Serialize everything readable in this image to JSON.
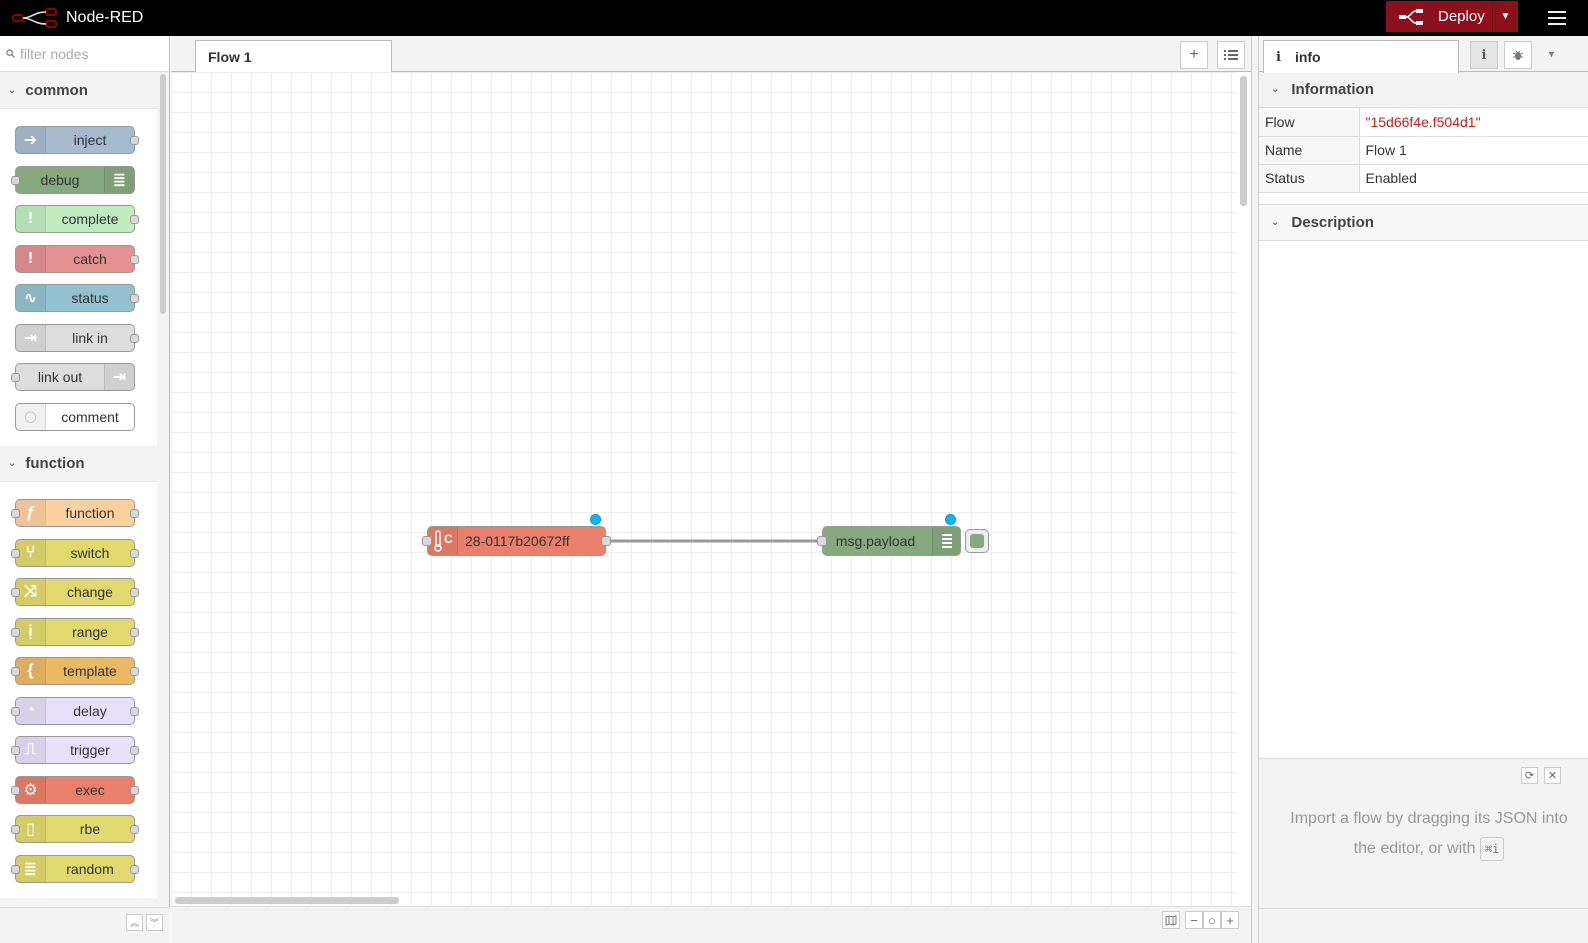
{
  "header": {
    "app_title": "Node-RED",
    "deploy_label": "Deploy"
  },
  "palette": {
    "search_placeholder": "filter nodes",
    "categories": [
      {
        "name": "common",
        "nodes": [
          {
            "label": "inject",
            "color": "#a6bbcf",
            "icon": "arrow-right-icon",
            "ports": "out"
          },
          {
            "label": "debug",
            "color": "#87a980",
            "icon": "list-icon",
            "ports": "in",
            "icon_side": "right"
          },
          {
            "label": "complete",
            "color": "#c0edc0",
            "icon": "exclamation-icon",
            "ports": "out"
          },
          {
            "label": "catch",
            "color": "#e49191",
            "icon": "exclamation-icon",
            "ports": "out"
          },
          {
            "label": "status",
            "color": "#94c1d0",
            "icon": "pulse-icon",
            "ports": "out"
          },
          {
            "label": "link in",
            "color": "#dddddd",
            "icon": "link-in-icon",
            "ports": "out"
          },
          {
            "label": "link out",
            "color": "#dddddd",
            "icon": "link-out-icon",
            "ports": "in",
            "icon_side": "right"
          },
          {
            "label": "comment",
            "color": "#ffffff",
            "icon": "comment-icon",
            "ports": "none"
          }
        ]
      },
      {
        "name": "function",
        "nodes": [
          {
            "label": "function",
            "color": "#fdd0a2",
            "icon": "function-icon",
            "ports": "both"
          },
          {
            "label": "switch",
            "color": "#e2d96e",
            "icon": "switch-icon",
            "ports": "both"
          },
          {
            "label": "change",
            "color": "#e2d96e",
            "icon": "shuffle-icon",
            "ports": "both"
          },
          {
            "label": "range",
            "color": "#e2d96e",
            "icon": "range-icon",
            "ports": "both"
          },
          {
            "label": "template",
            "color": "#ebb963",
            "icon": "brace-icon",
            "ports": "both"
          },
          {
            "label": "delay",
            "color": "#e6e0f8",
            "icon": "timer-icon",
            "ports": "both"
          },
          {
            "label": "trigger",
            "color": "#e6e0f8",
            "icon": "trigger-icon",
            "ports": "both"
          },
          {
            "label": "exec",
            "color": "#e9806b",
            "icon": "gear-icon",
            "ports": "both"
          },
          {
            "label": "rbe",
            "color": "#e2d96e",
            "icon": "rbe-icon",
            "ports": "both"
          },
          {
            "label": "random",
            "color": "#e2d96e",
            "icon": "random-icon",
            "ports": "both"
          }
        ]
      }
    ]
  },
  "workspace": {
    "tab_label": "Flow 1",
    "flow_nodes": [
      {
        "label": "28-0117b20672ff",
        "color": "#e9806b",
        "icon": "thermometer-icon",
        "glyph": "C"
      },
      {
        "label": "msg.payload",
        "color": "#87a980",
        "icon": "list-icon"
      }
    ]
  },
  "sidebar": {
    "tab_label": "info",
    "section_info": "Information",
    "section_desc": "Description",
    "rows": [
      {
        "key": "Flow",
        "value": "\"15d66f4e.f504d1\""
      },
      {
        "key": "Name",
        "value": "Flow 1"
      },
      {
        "key": "Status",
        "value": "Enabled"
      }
    ],
    "tip_text": "Import a flow by dragging its JSON into the editor, or with",
    "tip_kbd": "⌘i"
  },
  "colors": {
    "deploy_bg": "#8c101c",
    "header_bg": "#000000",
    "dirty_indicator": "#00bcff"
  }
}
